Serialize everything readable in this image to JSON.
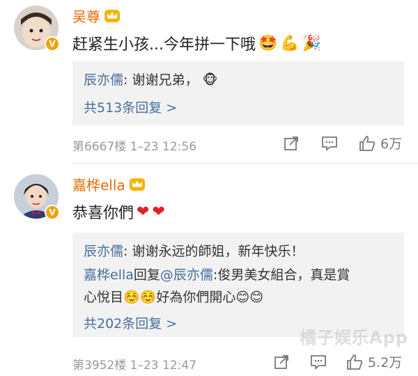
{
  "comments": [
    {
      "user": "吴尊",
      "text": "赶紧生小孩...今年拼一下哦",
      "replies": [
        {
          "author": "辰亦儒",
          "sep": ":",
          "text": " 谢谢兄弟，"
        }
      ],
      "more_replies": "共513条回复 >",
      "floor": "第6667楼",
      "time": "1–23 12:56",
      "likes": "6万"
    },
    {
      "user": "嘉桦ella",
      "text": "恭喜你們",
      "replies": [
        {
          "author": "辰亦儒",
          "sep": ":",
          "text": " 谢谢永远的師姐，新年快乐！"
        },
        {
          "author": "嘉桦ella",
          "mid": "回复",
          "mention": "@辰亦儒",
          "sep": ":",
          "text": "俊男美女組合，真是賞",
          "text2": "心悅目",
          "text3": "好為你們開心"
        }
      ],
      "more_replies": "共202条回复 >",
      "floor": "第3952楼",
      "time": "1–23 12:47",
      "likes": "5.2万"
    }
  ],
  "watermark": "橘子娱乐App",
  "colors": {
    "name": "#e86b0a",
    "link": "#4a6d9c",
    "reply_bg": "#f2f2f2",
    "meta": "#999999"
  }
}
